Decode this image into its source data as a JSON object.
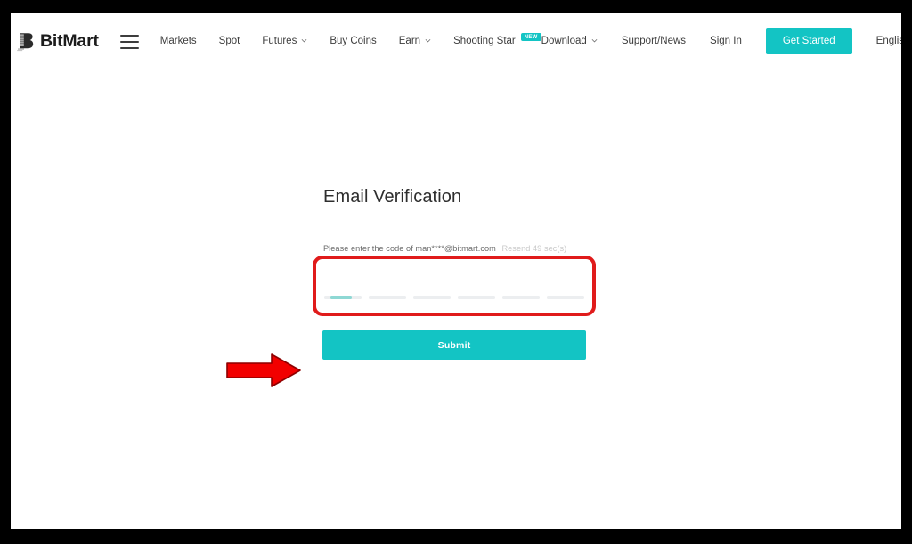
{
  "brand": {
    "name": "BitMart",
    "logo_icon": "bitmart-b-logo-icon"
  },
  "navbar": {
    "menu_icon": "hamburger-menu-icon",
    "left_items": [
      {
        "label": "Markets",
        "has_caret": false
      },
      {
        "label": "Spot",
        "has_caret": false
      },
      {
        "label": "Futures",
        "has_caret": true
      },
      {
        "label": "Buy Coins",
        "has_caret": false
      },
      {
        "label": "Earn",
        "has_caret": true
      },
      {
        "label": "Shooting Star",
        "has_caret": false,
        "badge": "NEW"
      }
    ],
    "right_items": [
      {
        "label": "Download",
        "has_caret": true
      },
      {
        "label": "Support/News",
        "has_caret": false
      },
      {
        "label": "Sign In",
        "has_caret": false
      }
    ],
    "cta_label": "Get Started",
    "language": "English",
    "accent_color": "#13c4c4"
  },
  "main": {
    "title": "Email Verification",
    "hint_text": "Please enter the code of man****@bitmart.com",
    "resend_text": "Resend 49 sec(s)",
    "code_input": {
      "value": "",
      "placeholder": "",
      "digits": 6,
      "active_index": 0,
      "cursor_color": "#8ed8d4",
      "cell_color": "#eceef0"
    },
    "submit_label": "Submit"
  },
  "annotations": {
    "highlight_color": "#e01b1b",
    "arrow_icon": "red-right-arrow-icon",
    "highlight_target": "code-input-field"
  }
}
